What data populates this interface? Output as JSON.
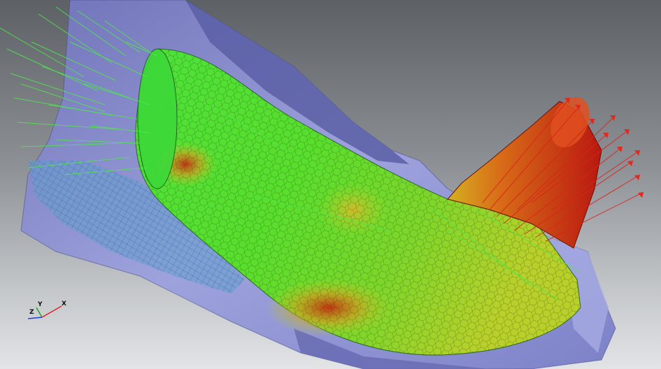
{
  "view": {
    "description_colors": {
      "background_top": "#5d6166",
      "background_bottom": "#e2e4e6",
      "housing": "#8b8fd0",
      "surface_low": "#2fd32a",
      "surface_mid": "#c8d62a",
      "surface_high": "#c81c10",
      "vector_inlet": "#4ee84a",
      "vector_outlet": "#d8241a"
    },
    "icons": [
      "axis-triad-icon"
    ]
  },
  "axis_triad": {
    "x_label": "X",
    "y_label": "Y",
    "z_label": "Z"
  }
}
